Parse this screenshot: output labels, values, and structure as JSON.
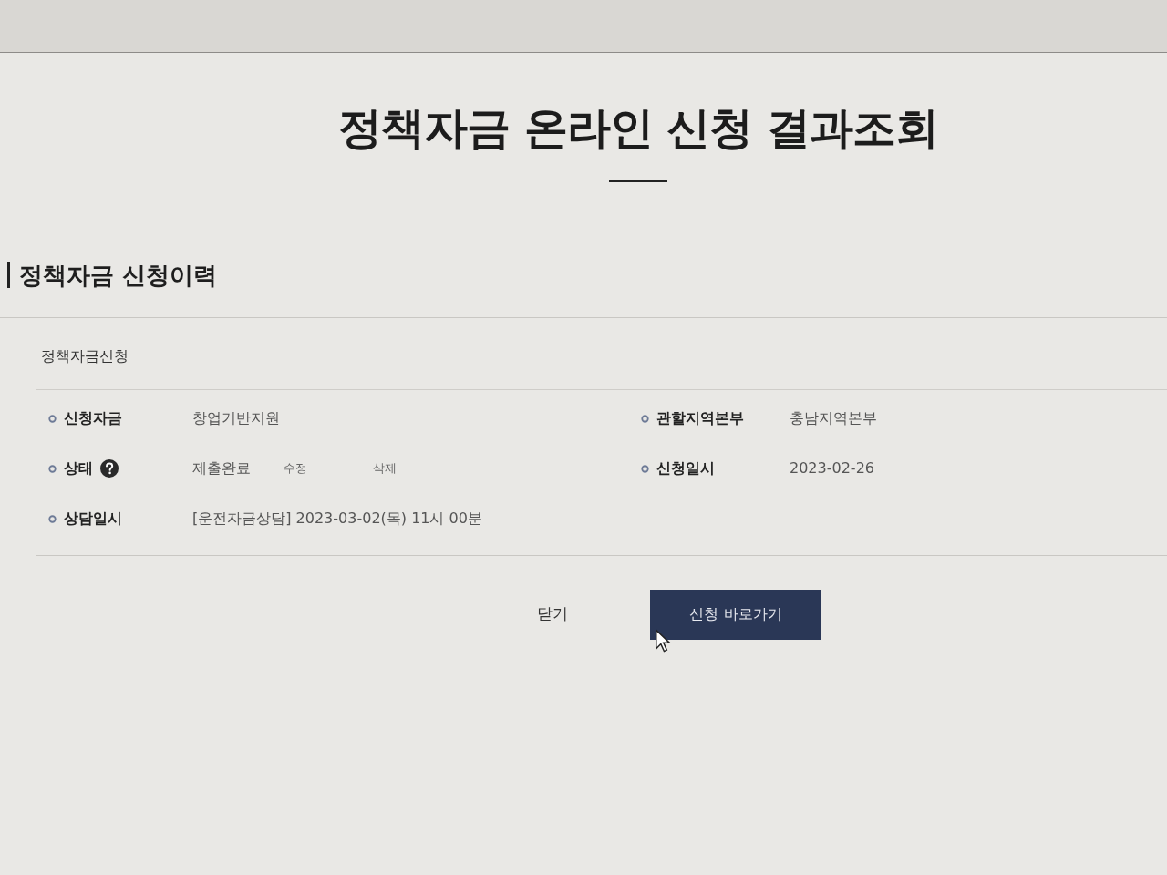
{
  "page_title": "정책자금 온라인 신청 결과조회",
  "section": {
    "title": "정책자금 신청이력",
    "card": {
      "title": "정책자금신청",
      "columns": [
        {
          "fields": [
            {
              "label": "신청자금",
              "help": false,
              "value": "창업기반지원"
            },
            {
              "label": "상태",
              "help": true,
              "value": "제출완료",
              "actions": [
                "수정",
                "삭제"
              ]
            },
            {
              "label": "상담일시",
              "help": false,
              "value": "[운전자금상담] 2023-03-02(목) 11시 00분"
            }
          ]
        },
        {
          "fields": [
            {
              "label": "관할지역본부",
              "help": false,
              "value": "충남지역본부"
            },
            {
              "label": "신청일시",
              "help": false,
              "value": "2023-02-26"
            }
          ]
        }
      ]
    }
  },
  "buttons": [
    {
      "label": "닫기",
      "kind": "text"
    },
    {
      "label": "신청 바로가기",
      "kind": "primary"
    }
  ]
}
